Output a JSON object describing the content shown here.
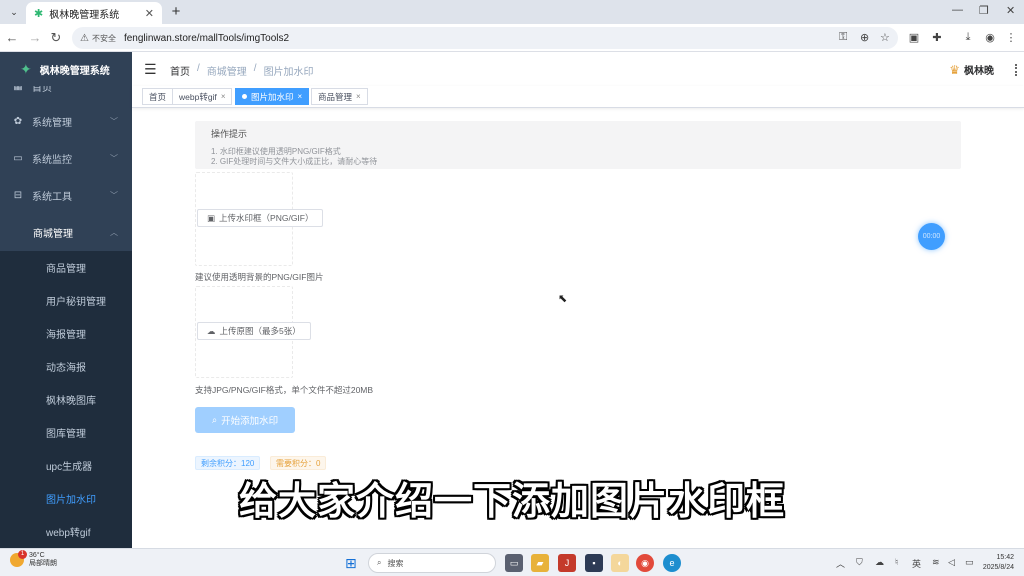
{
  "browser": {
    "tab_title": "枫林晚管理系统",
    "insecure_label": "不安全",
    "url": "fenglinwan.store/mallTools/imgTools2"
  },
  "sidebar": {
    "brand": "枫林晚管理系统",
    "items": [
      {
        "label": "首页",
        "icon": "dashboard-icon"
      },
      {
        "label": "系统管理",
        "icon": "gear-icon"
      },
      {
        "label": "系统监控",
        "icon": "monitor-icon"
      },
      {
        "label": "系统工具",
        "icon": "toolbox-icon"
      },
      {
        "label": "商城管理",
        "icon": "shop-icon"
      }
    ],
    "subitems": [
      {
        "label": "商品管理"
      },
      {
        "label": "用户秘钥管理"
      },
      {
        "label": "海报管理"
      },
      {
        "label": "动态海报"
      },
      {
        "label": "枫林晚图库"
      },
      {
        "label": "图库管理"
      },
      {
        "label": "upc生成器"
      },
      {
        "label": "图片加水印"
      },
      {
        "label": "webp转gif"
      }
    ],
    "active_subitem": "图片加水印"
  },
  "navbar": {
    "breadcrumb": [
      "首页",
      "/",
      "商城管理",
      "/",
      "图片加水印"
    ],
    "username": "枫林晚"
  },
  "tags": [
    {
      "label": "首页"
    },
    {
      "label": "webp转gif"
    },
    {
      "label": "图片加水印"
    },
    {
      "label": "商品管理"
    }
  ],
  "main": {
    "tips_title": "操作提示",
    "tips_line1": "1. 水印框建议使用透明PNG/GIF格式",
    "tips_line2": "2. GIF处理时间与文件大小成正比，请耐心等待",
    "upload_frame_label": "上传水印框（PNG/GIF）",
    "upload_frame_hint": "建议使用透明背景的PNG/GIF图片",
    "upload_image_label": "上传原图（最多5张）",
    "upload_image_hint": "支持JPG/PNG/GIF格式，单个文件不超过20MB",
    "start_label": "开始添加水印",
    "remaining_points": "剩余积分：120",
    "required_points": "需要积分：0",
    "timer": "00:00"
  },
  "subtitle": "给大家介绍一下添加图片水印框",
  "taskbar": {
    "temperature": "36°C",
    "weather": "局部晴朗",
    "weather_badge": "1",
    "search_placeholder": "搜索",
    "ime": "英",
    "time": "15:42",
    "date": "2025/8/24"
  },
  "colors": {
    "sidebar_bg": "#304156",
    "submenu_bg": "#1f2d3d",
    "accent": "#409eff",
    "start_btn": "#a0cfff"
  }
}
